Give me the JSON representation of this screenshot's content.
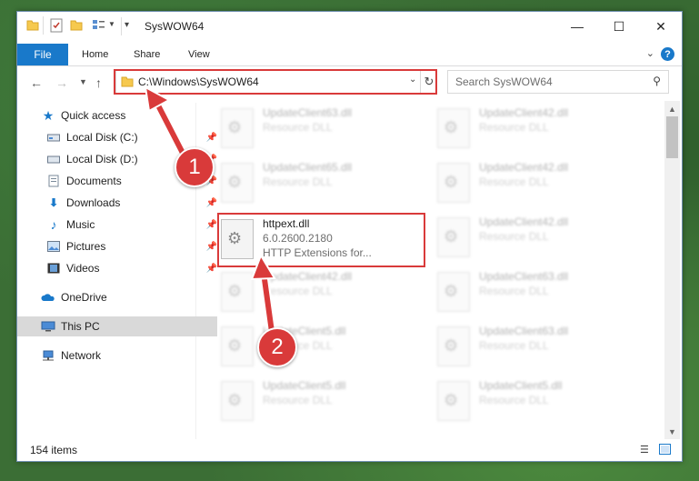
{
  "window": {
    "title": "SysWOW64",
    "controls": {
      "minimize": "—",
      "maximize": "☐",
      "close": "✕"
    }
  },
  "ribbon": {
    "tabs": [
      "File",
      "Home",
      "Share",
      "View"
    ],
    "help": "?"
  },
  "address": {
    "path": "C:\\Windows\\SysWOW64"
  },
  "search": {
    "placeholder": "Search SysWOW64"
  },
  "nav": {
    "items": [
      {
        "label": "Quick access",
        "icon": "star-icon"
      },
      {
        "label": "Local Disk (C:)",
        "icon": "drive-icon"
      },
      {
        "label": "Local Disk (D:)",
        "icon": "drive-icon"
      },
      {
        "label": "Documents",
        "icon": "documents-icon"
      },
      {
        "label": "Downloads",
        "icon": "download-icon"
      },
      {
        "label": "Music",
        "icon": "music-icon"
      },
      {
        "label": "Pictures",
        "icon": "pictures-icon"
      },
      {
        "label": "Videos",
        "icon": "videos-icon"
      },
      {
        "label": "OneDrive",
        "icon": "cloud-icon"
      },
      {
        "label": "This PC",
        "icon": "computer-icon"
      },
      {
        "label": "Network",
        "icon": "network-icon"
      }
    ]
  },
  "files": [
    {
      "name": "UpdateClient63.dll",
      "desc": "Resource DLL"
    },
    {
      "name": "UpdateClient42.dll",
      "desc": "Resource DLL"
    },
    {
      "name": "UpdateClient65.dll",
      "desc": "Resource DLL"
    },
    {
      "name": "UpdateClient42.dll",
      "desc": "Resource DLL"
    },
    {
      "name": "httpext.dll",
      "desc": "6.0.2600.2180",
      "desc2": "HTTP Extensions for..."
    },
    {
      "name": "UpdateClient42.dll",
      "desc": "Resource DLL"
    },
    {
      "name": "UpdateClient42.dll",
      "desc": "Resource DLL"
    },
    {
      "name": "UpdateClient63.dll",
      "desc": "Resource DLL"
    },
    {
      "name": "UpdateClient5.dll",
      "desc": "Resource DLL"
    },
    {
      "name": "UpdateClient63.dll",
      "desc": "Resource DLL"
    },
    {
      "name": "UpdateClient5.dll",
      "desc": "Resource DLL"
    },
    {
      "name": "UpdateClient5.dll",
      "desc": "Resource DLL"
    }
  ],
  "status": {
    "count": "154 items"
  },
  "annotations": {
    "step1": "1",
    "step2": "2"
  },
  "colors": {
    "accent": "#1979ca",
    "highlight": "#d93a3a"
  }
}
